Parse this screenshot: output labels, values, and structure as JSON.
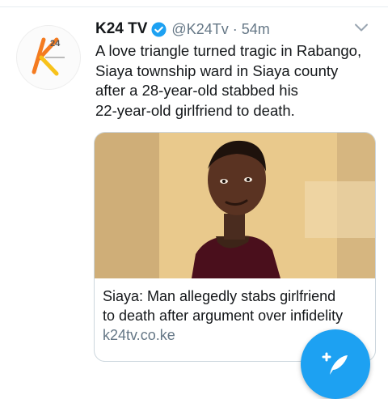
{
  "tweet": {
    "author_name": "K24 TV",
    "handle": "@K24Tv",
    "separator": "·",
    "time": "54m",
    "text_lines": [
      "A love triangle turned tragic in Rabango,",
      "Siaya township ward in Siaya county",
      "after a 28-year-old stabbed his",
      "22-year-old girlfriend to death."
    ]
  },
  "avatar": {
    "logo_text": "k24",
    "icon": "k24-logo"
  },
  "card": {
    "title_lines": [
      "Siaya: Man allegedly stabs girlfriend",
      "to death after argument over infidelity"
    ],
    "domain": "k24tv.co.ke"
  },
  "icons": {
    "verified": "verified-badge-icon",
    "menu": "chevron-down-icon",
    "compose": "compose-tweet-icon"
  },
  "colors": {
    "accent": "#1da1f2",
    "muted_text": "#657786",
    "logo_orange": "#f47b20",
    "logo_yellow": "#f7c21a"
  }
}
